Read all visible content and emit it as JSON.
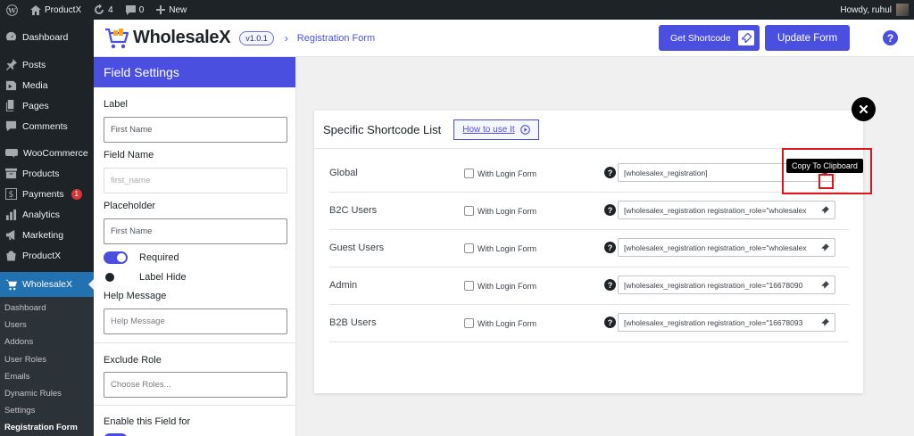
{
  "adminbar": {
    "site_name": "ProductX",
    "updates_count": "4",
    "comments_count": "0",
    "new_label": "New",
    "howdy": "Howdy, ruhul"
  },
  "sidebar": {
    "items": [
      {
        "label": "Dashboard",
        "icon": "dashboard-icon"
      },
      {
        "label": "Posts",
        "icon": "pin-icon"
      },
      {
        "label": "Media",
        "icon": "media-icon"
      },
      {
        "label": "Pages",
        "icon": "pages-icon"
      },
      {
        "label": "Comments",
        "icon": "comment-icon"
      },
      {
        "label": "WooCommerce",
        "icon": "woo-icon"
      },
      {
        "label": "Products",
        "icon": "archive-icon"
      },
      {
        "label": "Payments",
        "icon": "payments-icon",
        "badge": "1"
      },
      {
        "label": "Analytics",
        "icon": "chart-icon"
      },
      {
        "label": "Marketing",
        "icon": "megaphone-icon"
      },
      {
        "label": "ProductX",
        "icon": "productx-icon"
      },
      {
        "label": "WholesaleX",
        "icon": "cart-icon"
      }
    ],
    "submenu": [
      "Dashboard",
      "Users",
      "Addons",
      "User Roles",
      "Emails",
      "Dynamic Rules",
      "Settings",
      "Registration Form"
    ]
  },
  "header": {
    "logo": "WholesaleX",
    "version": "v1.0.1",
    "breadcrumb": "Registration Form",
    "get_shortcode": "Get Shortcode",
    "update_form": "Update Form",
    "help": "?"
  },
  "field_settings": {
    "title": "Field Settings",
    "label_title": "Label",
    "label_value": "First Name",
    "field_name_title": "Field Name",
    "field_name_placeholder": "first_name",
    "placeholder_title": "Placeholder",
    "placeholder_value": "First Name",
    "required_label": "Required",
    "required_on": true,
    "label_hide_label": "Label Hide",
    "label_hide_on": false,
    "help_message_title": "Help Message",
    "help_message_placeholder": "Help Message",
    "exclude_role_title": "Exclude Role",
    "exclude_role_placeholder": "Choose Roles...",
    "enable_field_title": "Enable this Field for"
  },
  "modal": {
    "title": "Specific Shortcode List",
    "how_to": "How to use It",
    "checkbox_label": "With Login Form",
    "rows": [
      {
        "name": "Global",
        "shortcode": "[wholesalex_registration]"
      },
      {
        "name": "B2C Users",
        "shortcode": "[wholesalex_registration registration_role=\"wholesalex"
      },
      {
        "name": "Guest Users",
        "shortcode": "[wholesalex_registration registration_role=\"wholesalex"
      },
      {
        "name": "Admin",
        "shortcode": "[wholesalex_registration registration_role=\"16678090"
      },
      {
        "name": "B2B Users",
        "shortcode": "[wholesalex_registration registration_role=\"16678093"
      }
    ],
    "tooltip": "Copy To Clipboard"
  },
  "colors": {
    "accent": "#4b4fe0",
    "admin_dark": "#1d2327",
    "wp_blue": "#2271b1",
    "highlight_red": "#e0151c"
  }
}
